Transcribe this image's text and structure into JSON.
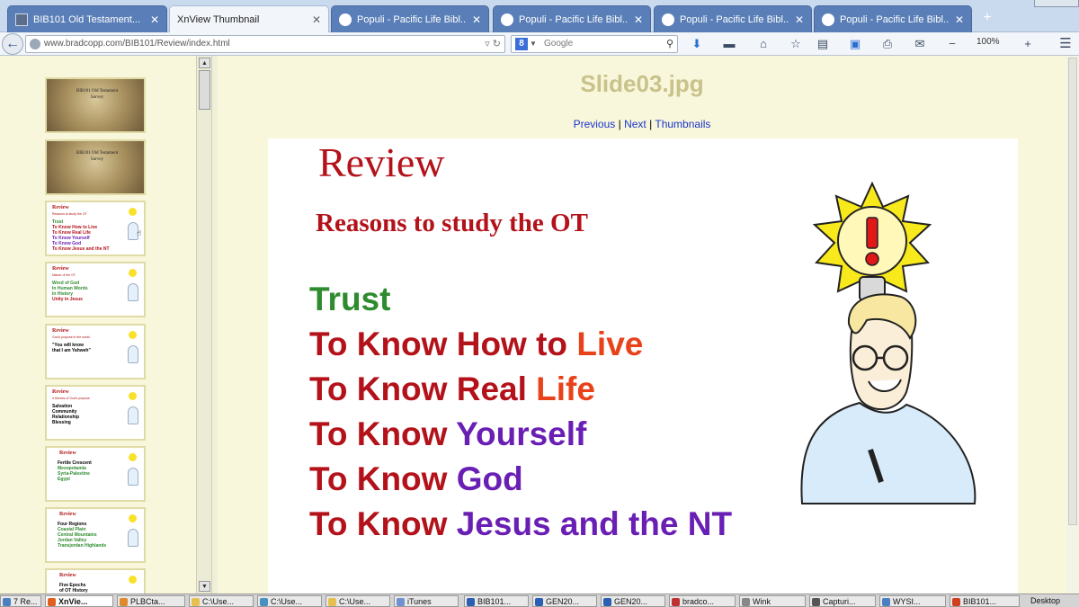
{
  "browser": {
    "tabs": [
      {
        "label": "BIB101 Old Testament...",
        "active": false
      },
      {
        "label": "XnView Thumbnail",
        "active": true
      },
      {
        "label": "Populi - Pacific Life Bibl...",
        "active": false
      },
      {
        "label": "Populi - Pacific Life Bibl...",
        "active": false
      },
      {
        "label": "Populi - Pacific Life Bibl...",
        "active": false
      },
      {
        "label": "Populi - Pacific Life Bibl...",
        "active": false
      }
    ],
    "url": "www.bradcopp.com/BIB101/Review/index.html",
    "search_placeholder": "Google",
    "zoom": "100%",
    "close_glyph": "✕",
    "new_tab_glyph": "+"
  },
  "sidebar": {
    "thumbnails": [
      {
        "kind": "photo",
        "text": "BIB101 Old Testament Survey"
      },
      {
        "kind": "photo",
        "text": "BIB101 Old Testament Survey"
      },
      {
        "kind": "slide",
        "head": "Review",
        "sub": "Reasons to study the OT",
        "lines": [
          {
            "text": "Trust",
            "color": "#2e8b2e"
          },
          {
            "text": "To Know How to Live",
            "color": "#b3121a"
          },
          {
            "text": "To Know Real Life",
            "color": "#b3121a"
          },
          {
            "text": "To Know Yourself",
            "color": "#6a1fb4"
          },
          {
            "text": "To Know God",
            "color": "#6a1fb4"
          },
          {
            "text": "To Know Jesus and the NT",
            "color": "#b3121a"
          }
        ]
      },
      {
        "kind": "slide",
        "head": "Review",
        "sub": "Nature of the OT",
        "lines": [
          {
            "text": "Word of God",
            "color": "#2e8b2e"
          },
          {
            "text": "In Human Words",
            "color": "#2e8b2e"
          },
          {
            "text": "In History",
            "color": "#2e8b2e"
          },
          {
            "text": "",
            "color": "#000"
          },
          {
            "text": "Unity in Jesus",
            "color": "#b3121a"
          }
        ]
      },
      {
        "kind": "slide",
        "head": "Review",
        "sub": "God's purpose in the world",
        "lines": [
          {
            "text": "",
            "color": "#000"
          },
          {
            "text": "\"You will know",
            "color": "#000"
          },
          {
            "text": "that I am Yahweh\"",
            "color": "#000"
          }
        ]
      },
      {
        "kind": "slide",
        "head": "Review",
        "sub": "4 themes of God's purpose",
        "lines": [
          {
            "text": "Salvation",
            "color": "#000"
          },
          {
            "text": "Community",
            "color": "#000"
          },
          {
            "text": "Relationship",
            "color": "#000"
          },
          {
            "text": "Blessing",
            "color": "#000"
          }
        ]
      },
      {
        "kind": "slide",
        "head": "Review",
        "sub": "",
        "lines": [
          {
            "text": "Fertile Crescent",
            "color": "#000"
          },
          {
            "text": "Mesopotamia",
            "color": "#2e8b2e"
          },
          {
            "text": "Syria-Palestine",
            "color": "#2e8b2e"
          },
          {
            "text": "Egypt",
            "color": "#2e8b2e"
          }
        ]
      },
      {
        "kind": "slide",
        "head": "Review",
        "sub": "",
        "lines": [
          {
            "text": "Four Regions",
            "color": "#000"
          },
          {
            "text": "Coastal Plain",
            "color": "#2e8b2e"
          },
          {
            "text": "Central Mountains",
            "color": "#2e8b2e"
          },
          {
            "text": "Jordan Valley",
            "color": "#2e8b2e"
          },
          {
            "text": "Transjordan Highlands",
            "color": "#2e8b2e"
          }
        ]
      },
      {
        "kind": "slide",
        "head": "Review",
        "sub": "",
        "lines": [
          {
            "text": "Five Epochs",
            "color": "#000"
          },
          {
            "text": "of OT History",
            "color": "#000"
          }
        ]
      }
    ]
  },
  "main": {
    "title": "Slide03.jpg",
    "nav": {
      "previous": "Previous",
      "next": "Next",
      "thumbnails": "Thumbnails",
      "separator": "|"
    },
    "slide": {
      "title": "Review",
      "subtitle": "Reasons to study the OT",
      "lines": [
        {
          "prefix": "Trust",
          "prefix_color": "#2e8b2e",
          "highlight": "",
          "highlight_color": "#2e8b2e"
        },
        {
          "prefix": "To Know How to ",
          "prefix_color": "#b3121a",
          "highlight": "Live",
          "highlight_color": "#e8421a"
        },
        {
          "prefix": "To Know Real ",
          "prefix_color": "#b3121a",
          "highlight": "Life",
          "highlight_color": "#e8421a"
        },
        {
          "prefix": "To Know ",
          "prefix_color": "#b3121a",
          "highlight": "Yourself",
          "highlight_color": "#6a1fb4"
        },
        {
          "prefix": "To Know ",
          "prefix_color": "#b3121a",
          "highlight": "God",
          "highlight_color": "#6a1fb4"
        },
        {
          "prefix": "To Know ",
          "prefix_color": "#b3121a",
          "highlight": "Jesus and the NT",
          "highlight_color": "#6a1fb4"
        }
      ]
    }
  },
  "taskbar": {
    "items": [
      {
        "label": "7 Re...",
        "color": "#4a7fc0"
      },
      {
        "label": "XnVie...",
        "color": "#e06020",
        "active": true
      },
      {
        "label": "PLBCta...",
        "color": "#e08a30"
      },
      {
        "label": "C:\\Use...",
        "color": "#e8c050"
      },
      {
        "label": "C:\\Use...",
        "color": "#4a90c0"
      },
      {
        "label": "C:\\Use...",
        "color": "#e8c050"
      },
      {
        "label": "iTunes",
        "color": "#7090d0"
      },
      {
        "label": "BIB101...",
        "color": "#2b5fb3"
      },
      {
        "label": "GEN20...",
        "color": "#2b5fb3"
      },
      {
        "label": "GEN20...",
        "color": "#2b5fb3"
      },
      {
        "label": "bradco...",
        "color": "#c03030"
      },
      {
        "label": "Wink",
        "color": "#888888"
      },
      {
        "label": "Capturi...",
        "color": "#555555"
      },
      {
        "label": "WYSI...",
        "color": "#4a7fc0"
      },
      {
        "label": "BIB101...",
        "color": "#d04020"
      },
      {
        "label": "Desktop",
        "color": "#d4d4d4"
      }
    ]
  }
}
